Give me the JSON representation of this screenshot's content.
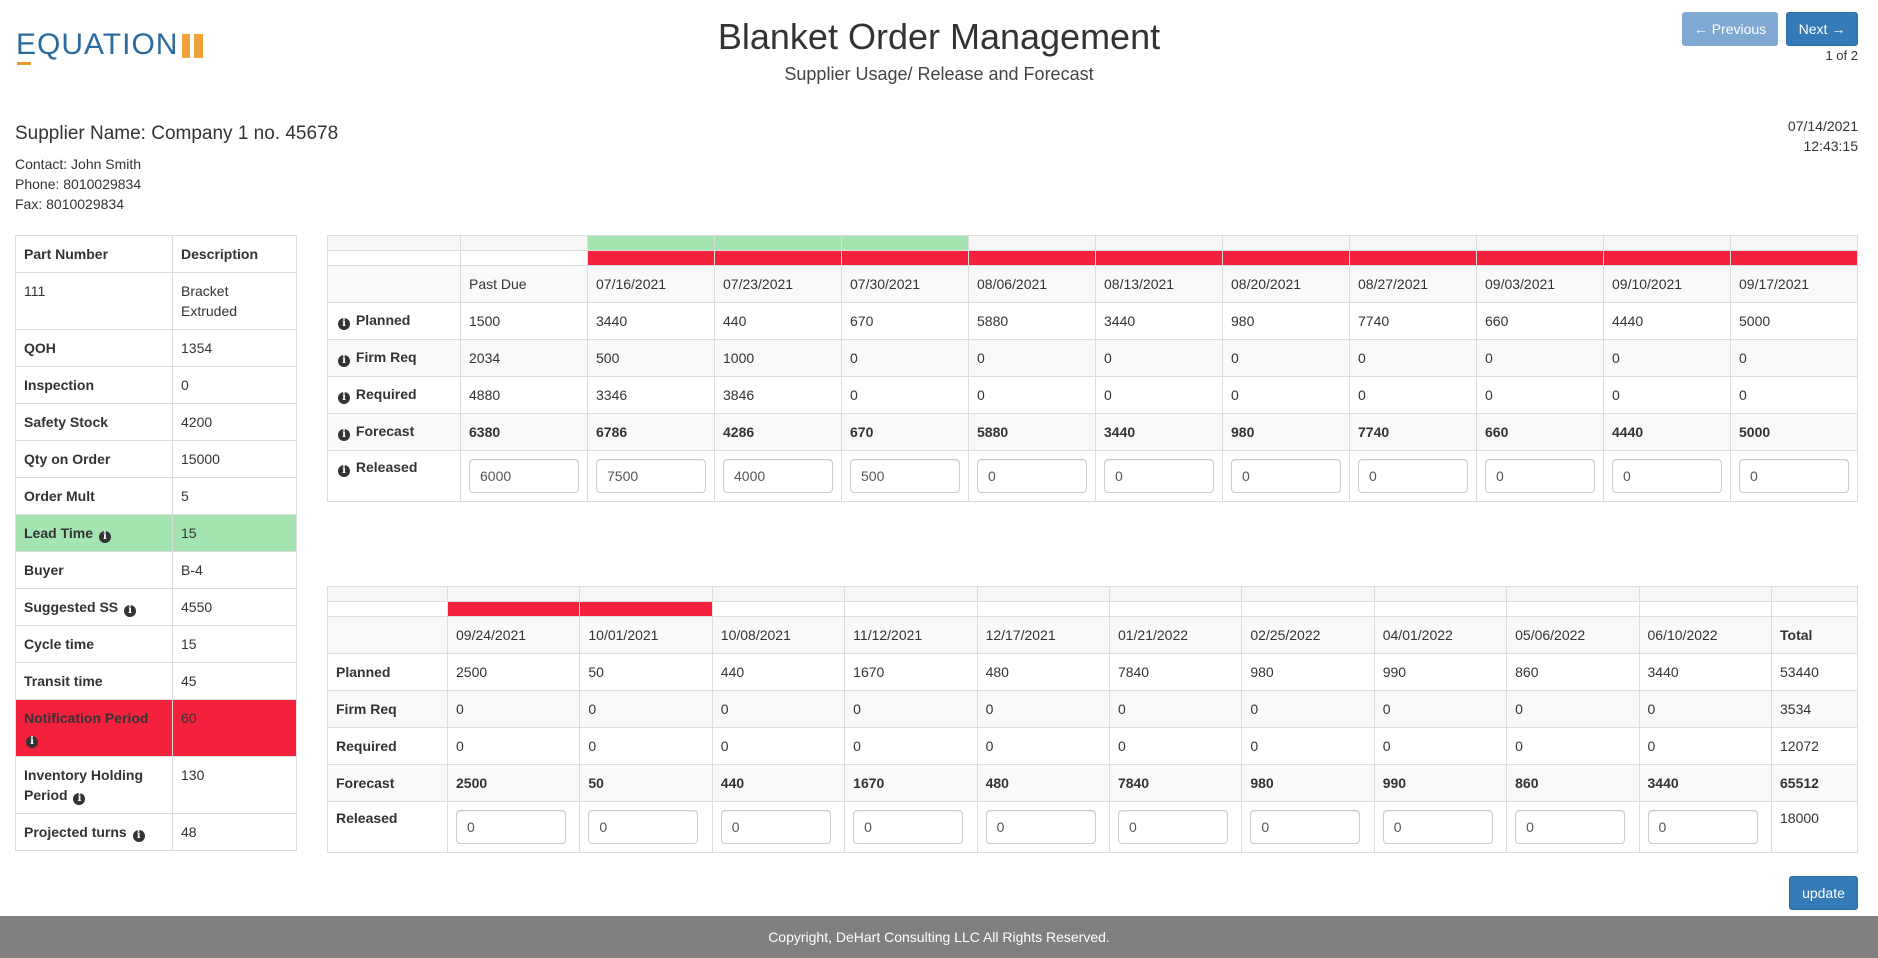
{
  "logo": {
    "first": "E",
    "rest": "QUATION"
  },
  "header": {
    "title": "Blanket Order Management",
    "subtitle": "Supplier Usage/ Release and Forecast",
    "prev_label": "← Previous",
    "next_label": "Next →",
    "page_indicator": "1 of 2",
    "date": "07/14/2021",
    "time": "12:43:15"
  },
  "supplier": {
    "name": "Supplier Name: Company 1 no. 45678",
    "contact": "Contact: John Smith",
    "phone": "Phone: 8010029834",
    "fax": "Fax: 8010029834"
  },
  "part_info": {
    "header_part": "Part Number",
    "header_desc": "Description",
    "part_number": "111",
    "description": "Bracket Extruded",
    "rows": [
      {
        "label": "QOH",
        "value": "1354"
      },
      {
        "label": "Inspection",
        "value": "0"
      },
      {
        "label": "Safety Stock",
        "value": "4200"
      },
      {
        "label": "Qty on Order",
        "value": "15000"
      },
      {
        "label": "Order Mult",
        "value": "5"
      },
      {
        "label": "Lead Time",
        "value": "15"
      },
      {
        "label": "Buyer",
        "value": "B-4"
      },
      {
        "label": "Suggested SS",
        "value": "4550"
      },
      {
        "label": "Cycle time",
        "value": "15"
      },
      {
        "label": "Transit time",
        "value": "45"
      },
      {
        "label": "Notification Period",
        "value": "60"
      },
      {
        "label": "Inventory Holding Period",
        "value": "130"
      },
      {
        "label": "Projected turns",
        "value": "48"
      }
    ]
  },
  "colors": {
    "green": "#a3e4b0",
    "red": "#f4213c",
    "primary": "#337ab7"
  },
  "grid1": {
    "dates": [
      "Past Due",
      "07/16/2021",
      "07/23/2021",
      "07/30/2021",
      "08/06/2021",
      "08/13/2021",
      "08/20/2021",
      "08/27/2021",
      "09/03/2021",
      "09/10/2021",
      "09/17/2021"
    ],
    "row_labels": {
      "planned": "Planned",
      "firm": "Firm Req",
      "required": "Required",
      "forecast": "Forecast",
      "released": "Released"
    },
    "planned": [
      "1500",
      "3440",
      "440",
      "670",
      "5880",
      "3440",
      "980",
      "7740",
      "660",
      "4440",
      "5000"
    ],
    "firm": [
      "2034",
      "500",
      "1000",
      "0",
      "0",
      "0",
      "0",
      "0",
      "0",
      "0",
      "0"
    ],
    "required": [
      "4880",
      "3346",
      "3846",
      "0",
      "0",
      "0",
      "0",
      "0",
      "0",
      "0",
      "0"
    ],
    "forecast": [
      "6380",
      "6786",
      "4286",
      "670",
      "5880",
      "3440",
      "980",
      "7740",
      "660",
      "4440",
      "5000"
    ],
    "released": [
      "6000",
      "7500",
      "4000",
      "500",
      "0",
      "0",
      "0",
      "0",
      "0",
      "0",
      "0"
    ]
  },
  "grid2": {
    "dates": [
      "09/24/2021",
      "10/01/2021",
      "10/08/2021",
      "11/12/2021",
      "12/17/2021",
      "01/21/2022",
      "02/25/2022",
      "04/01/2022",
      "05/06/2022",
      "06/10/2022"
    ],
    "total_label": "Total",
    "row_labels": {
      "planned": "Planned",
      "firm": "Firm Req",
      "required": "Required",
      "forecast": "Forecast",
      "released": "Released"
    },
    "planned": [
      "2500",
      "50",
      "440",
      "1670",
      "480",
      "7840",
      "980",
      "990",
      "860",
      "3440"
    ],
    "firm": [
      "0",
      "0",
      "0",
      "0",
      "0",
      "0",
      "0",
      "0",
      "0",
      "0"
    ],
    "required": [
      "0",
      "0",
      "0",
      "0",
      "0",
      "0",
      "0",
      "0",
      "0",
      "0"
    ],
    "forecast": [
      "2500",
      "50",
      "440",
      "1670",
      "480",
      "7840",
      "980",
      "990",
      "860",
      "3440"
    ],
    "released": [
      "0",
      "0",
      "0",
      "0",
      "0",
      "0",
      "0",
      "0",
      "0",
      "0"
    ],
    "totals": {
      "planned": "53440",
      "firm": "3534",
      "required": "12072",
      "forecast": "65512",
      "released": "18000"
    }
  },
  "update_label": "update",
  "footer": "Copyright, DeHart Consulting LLC All Rights Reserved."
}
